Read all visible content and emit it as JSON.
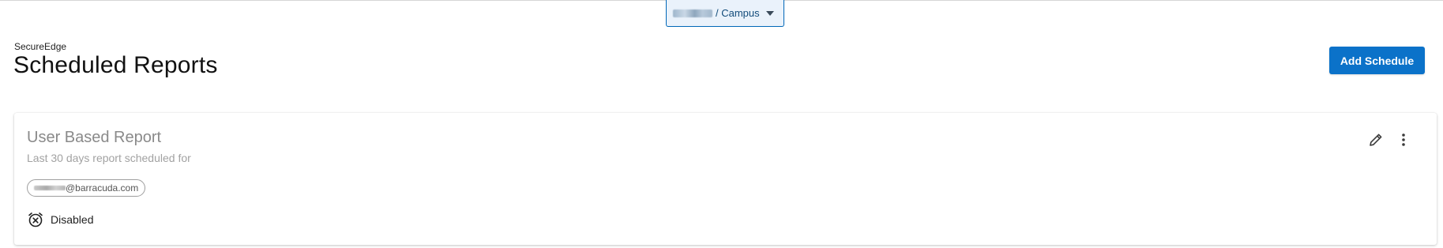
{
  "tenant_selector": {
    "label": "/ Campus",
    "icon": "chevron-down-icon"
  },
  "header": {
    "app_name": "SecureEdge",
    "title": "Scheduled Reports",
    "add_button_label": "Add Schedule"
  },
  "reports": [
    {
      "title": "User Based Report",
      "subtitle": "Last 30 days report scheduled for",
      "recipient_domain": "@barracuda.com",
      "status": "Disabled",
      "status_icon": "alarm-off-icon",
      "actions": [
        "pencil-icon",
        "more-vertical-icon"
      ]
    }
  ],
  "colors": {
    "accent": "#0b72c9",
    "selector_border": "#0067b8",
    "card_title": "#8a8a8a"
  }
}
